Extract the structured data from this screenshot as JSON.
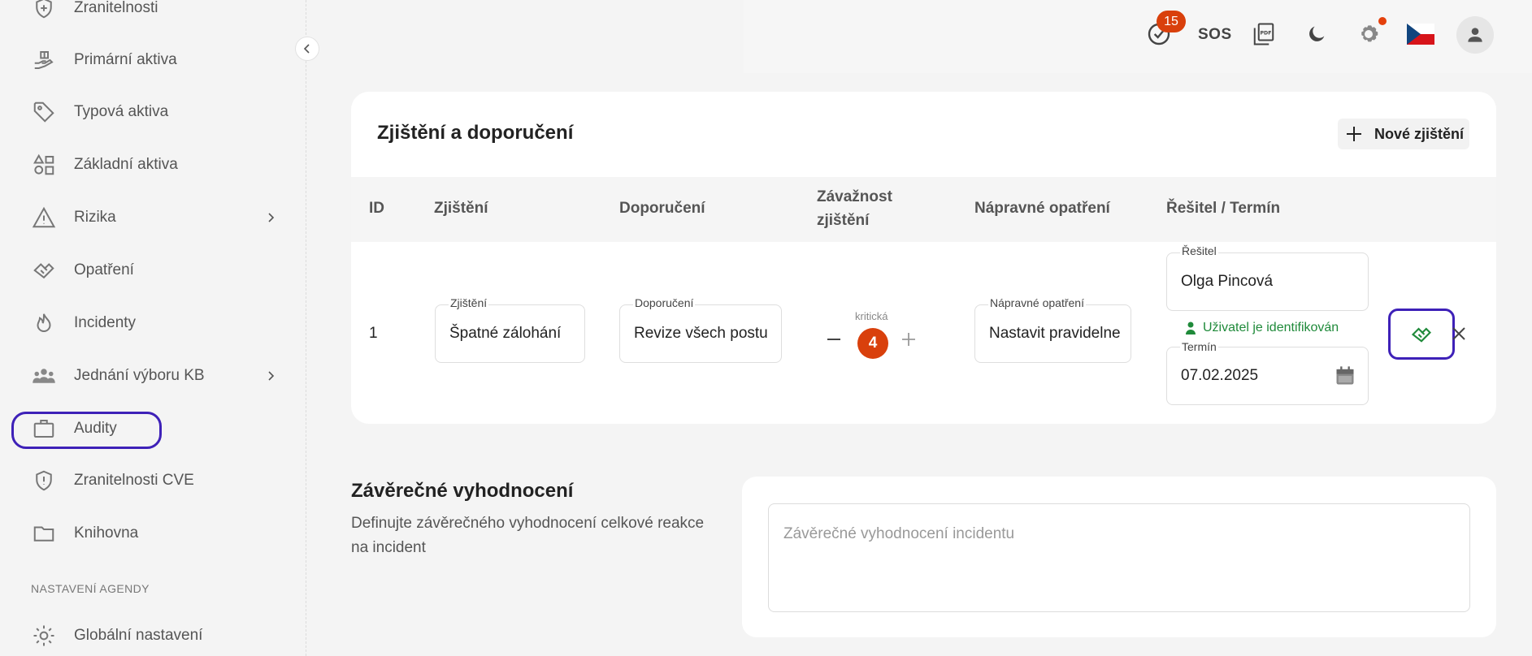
{
  "sidebar": {
    "items": [
      {
        "label": "Zranitelnosti",
        "icon": "shield-plus-icon"
      },
      {
        "label": "Primární aktiva",
        "icon": "hand-assets-icon"
      },
      {
        "label": "Typová aktiva",
        "icon": "tag-icon"
      },
      {
        "label": "Základní aktiva",
        "icon": "shapes-icon"
      },
      {
        "label": "Rizika",
        "icon": "warning-icon"
      },
      {
        "label": "Opatření",
        "icon": "handshake-icon"
      },
      {
        "label": "Incidenty",
        "icon": "flame-icon"
      },
      {
        "label": "Jednání výboru KB",
        "icon": "people-icon"
      },
      {
        "label": "Audity",
        "icon": "briefcase-icon"
      },
      {
        "label": "Zranitelnosti CVE",
        "icon": "shield-alert-icon"
      },
      {
        "label": "Knihovna",
        "icon": "folder-icon"
      },
      {
        "label": "Globální nastavení",
        "icon": "gear-icon"
      }
    ],
    "section_label": "NASTAVENÍ AGENDY"
  },
  "header": {
    "tasks_badge": "15",
    "sos_label": "SOS"
  },
  "findings": {
    "title": "Zjištění a doporučení",
    "new_button": "Nové zjištění",
    "columns": {
      "id": "ID",
      "finding": "Zjištění",
      "recommendation": "Doporučení",
      "severity_line1": "Závažnost",
      "severity_line2": "zjištění",
      "corrective": "Nápravné opatření",
      "solver": "Řešitel / Termín"
    },
    "row": {
      "id": "1",
      "finding_label": "Zjištění",
      "finding_value": "Špatné zálohání",
      "recommendation_label": "Doporučení",
      "recommendation_value": "Revize všech postu",
      "severity_text": "kritická",
      "severity_value": "4",
      "corrective_label": "Nápravné opatření",
      "corrective_value": "Nastavit pravidelne",
      "solver_label": "Řešitel",
      "solver_value": "Olga Pincová",
      "identified_text": "Uživatel je identifikován",
      "deadline_label": "Termín",
      "deadline_value": "07.02.2025"
    }
  },
  "final": {
    "title": "Závěrečné vyhodnocení",
    "description": "Definujte závěrečného vyhodnocení celkové reakce na incident",
    "placeholder": "Závěrečné vyhodnocení incidentu"
  },
  "colors": {
    "accent_outline": "#3e21b8",
    "badge": "#d9400c",
    "success": "#1f8a3a"
  }
}
